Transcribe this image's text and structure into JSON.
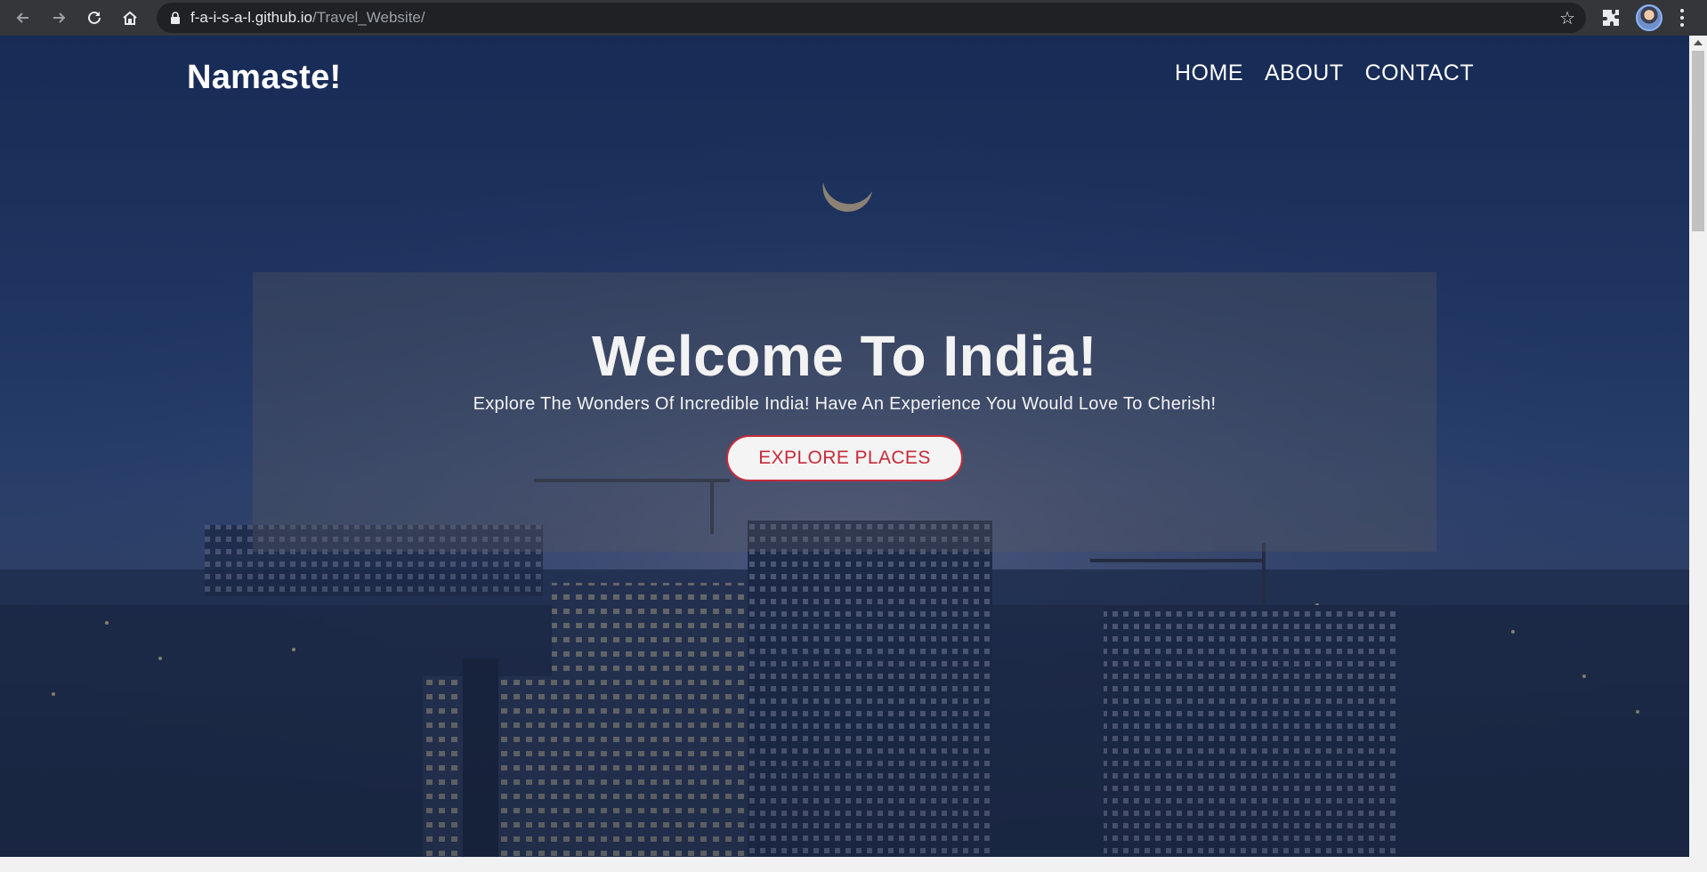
{
  "browser": {
    "url_host": "f-a-i-s-a-l.github.io",
    "url_path": "/Travel_Website/",
    "icons": [
      "back-icon",
      "forward-icon",
      "reload-icon",
      "home-icon",
      "lock-icon",
      "star-icon",
      "puzzle-icon",
      "kebab-menu-icon"
    ],
    "colors": {
      "chrome": "#35363a",
      "omnibox": "#202124"
    }
  },
  "site": {
    "logo": "Namaste!",
    "nav": [
      "HOME",
      "ABOUT",
      "CONTACT"
    ]
  },
  "hero": {
    "title": "Welcome To India!",
    "subtitle": "Explore The Wonders Of Incredible India! Have An Experience You Would Love To Cherish!",
    "cta": "EXPLORE PLACES",
    "colors": {
      "accent": "#c62b3a",
      "button_bg": "#f4f4f4",
      "overlay": "#1b2c4e"
    }
  }
}
